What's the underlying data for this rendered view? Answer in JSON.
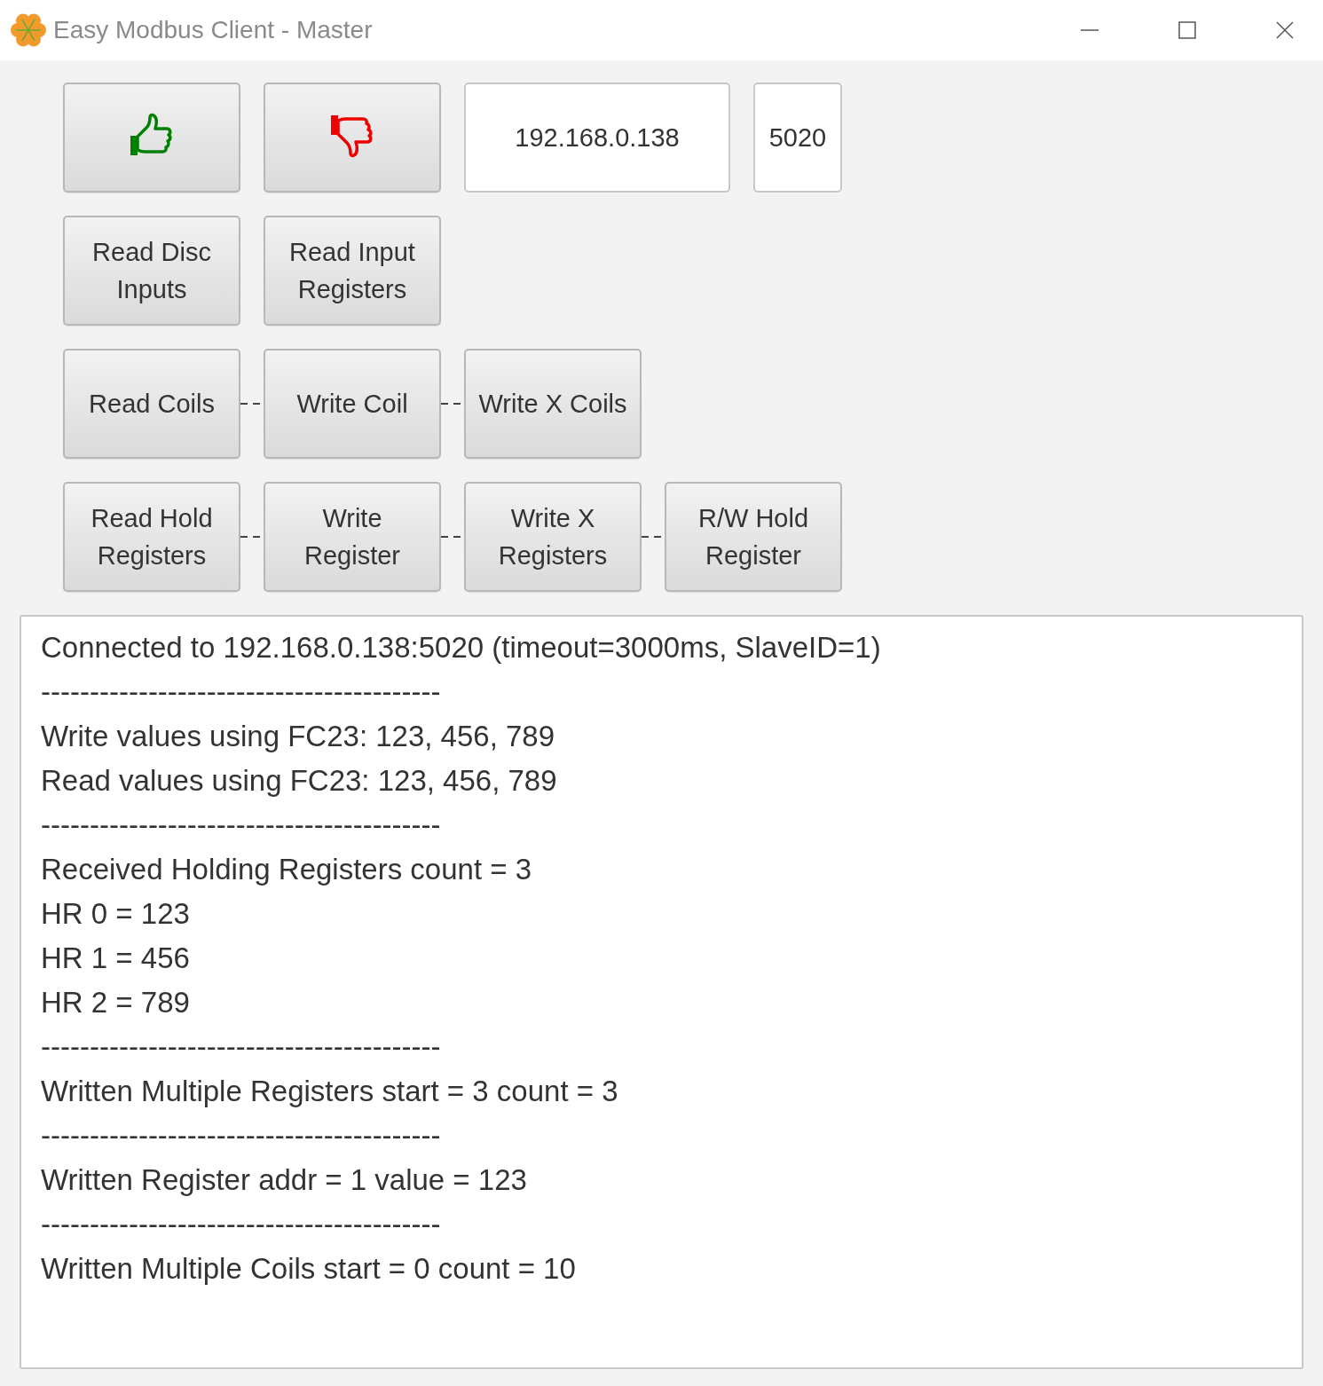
{
  "window": {
    "title": "Easy Modbus Client - Master"
  },
  "connection": {
    "buttons": [
      {
        "kind": "connect"
      },
      {
        "kind": "disconnect"
      }
    ],
    "ip_field": {
      "value": "192.168.0.138"
    },
    "port_field": {
      "value": "5020"
    }
  },
  "function_rows": [
    {
      "linked": false,
      "buttons": [
        "Read Disc Inputs",
        "Read Input Registers"
      ]
    },
    {
      "linked": true,
      "buttons": [
        "Read Coils",
        "Write Coil",
        "Write X Coils"
      ]
    },
    {
      "linked": true,
      "buttons": [
        "Read Hold Registers",
        "Write Register",
        "Write X Registers",
        "R/W Hold Register"
      ]
    }
  ],
  "log": {
    "lines": [
      "Connected to 192.168.0.138:5020 (timeout=3000ms, SlaveID=1)",
      "-----------------------------------------",
      "Write values using FC23: 123, 456, 789",
      "Read values using FC23: 123, 456, 789",
      "-----------------------------------------",
      "Received Holding Registers count = 3",
      "HR 0 = 123",
      "HR 1 = 456",
      "HR 2 = 789",
      "-----------------------------------------",
      "Written Multiple Registers start = 3 count = 3",
      "-----------------------------------------",
      "Written Register addr = 1 value = 123",
      "-----------------------------------------",
      "Written Multiple Coils start = 0 count = 10"
    ]
  }
}
